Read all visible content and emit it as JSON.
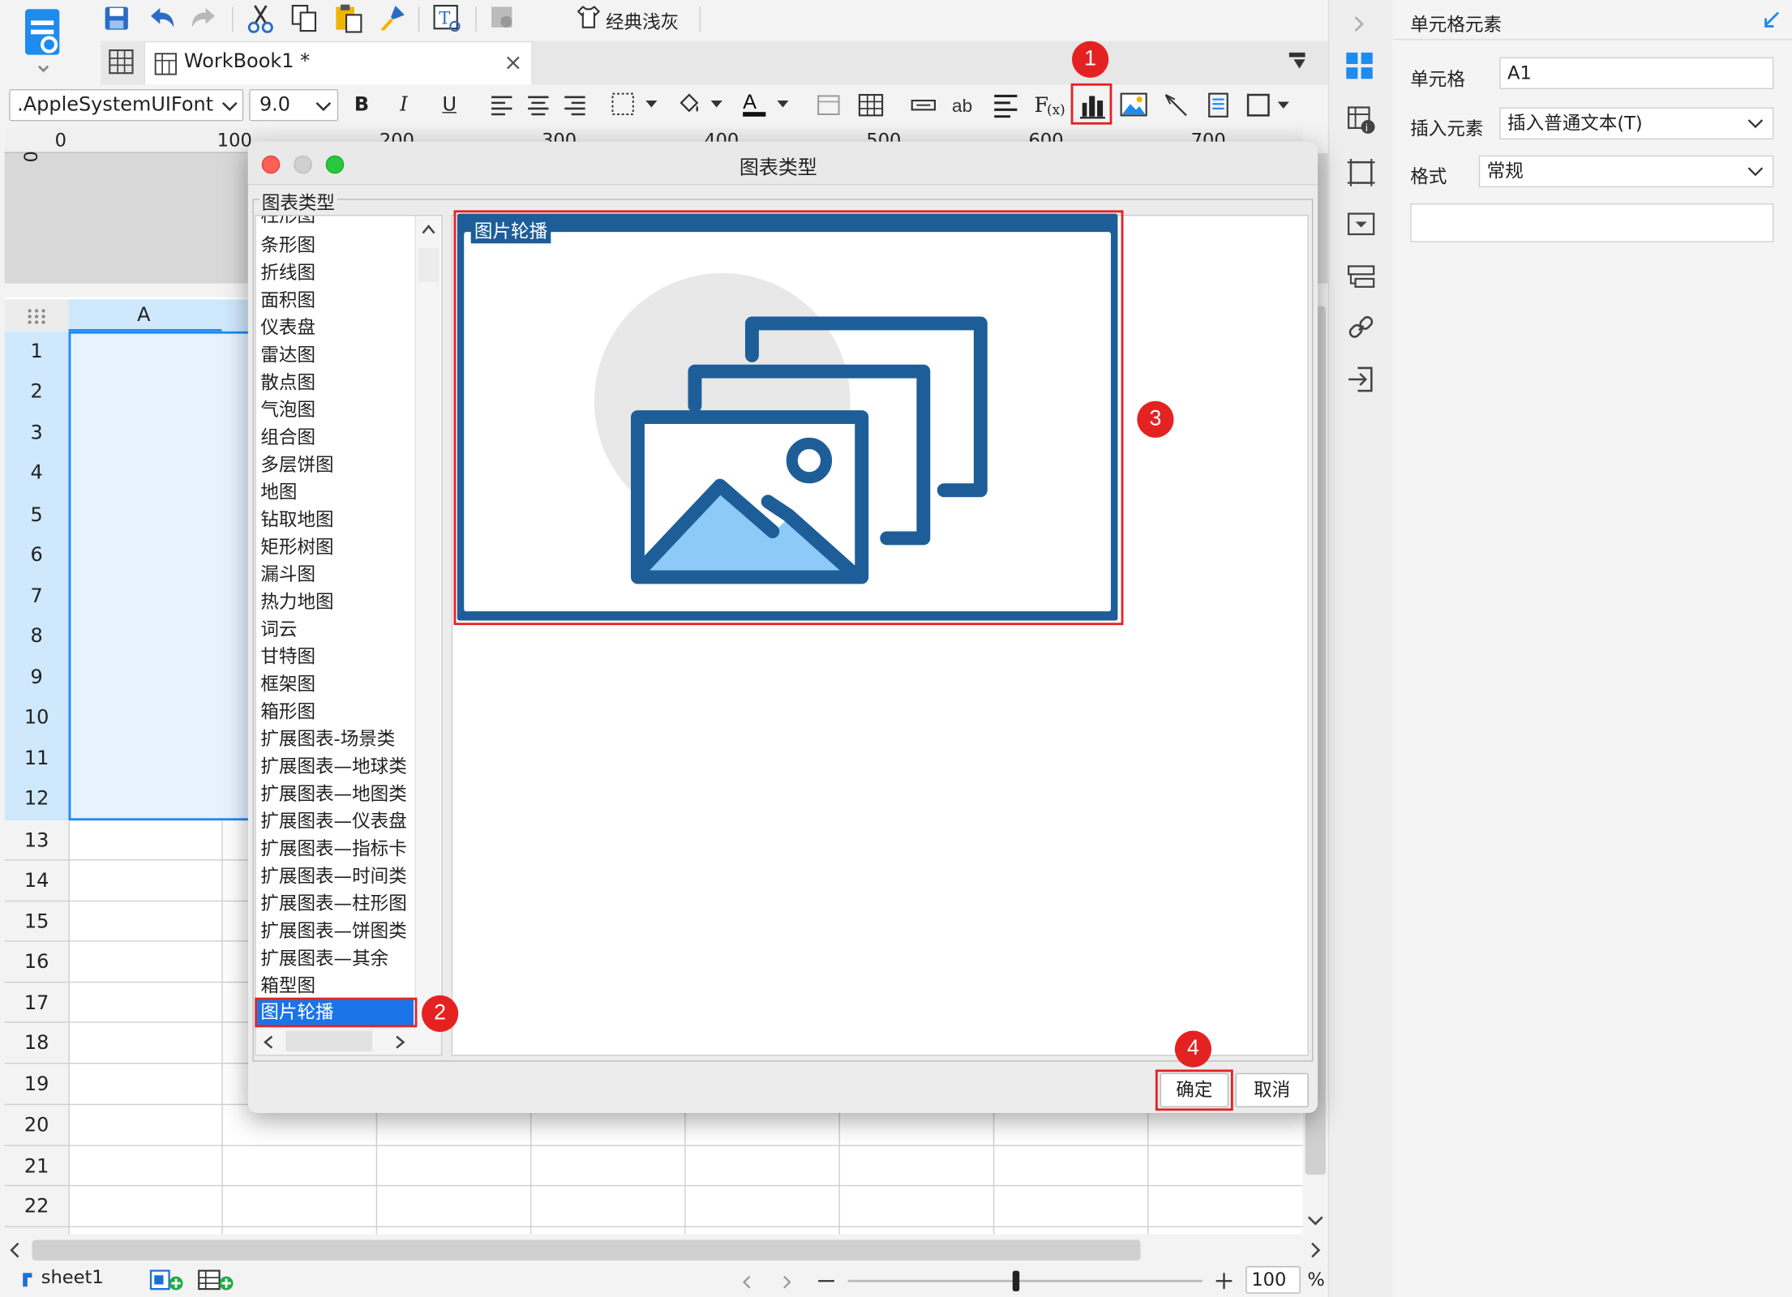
{
  "toolbar": {
    "theme_label": "经典浅灰",
    "font_name": ".AppleSystemUIFont",
    "font_size": "9.0",
    "bold": "B",
    "italic": "I",
    "underline": "U"
  },
  "tabs": {
    "workbook_label": "WorkBook1 *"
  },
  "ruler": {
    "ticks": [
      "0",
      "100",
      "200",
      "300",
      "400",
      "500",
      "600",
      "700"
    ]
  },
  "sheet": {
    "column_a": "A",
    "row_numbers": [
      "1",
      "2",
      "3",
      "4",
      "5",
      "6",
      "7",
      "8",
      "9",
      "10",
      "11",
      "12",
      "13",
      "14",
      "15",
      "16",
      "17",
      "18",
      "19",
      "20",
      "21",
      "22"
    ],
    "sheet_tab": "sheet1",
    "zoom": "100",
    "zoom_unit": "%"
  },
  "dialog": {
    "title": "图表类型",
    "group_label": "图表类型",
    "chart_types": [
      "柱形图",
      "条形图",
      "折线图",
      "面积图",
      "仪表盘",
      "雷达图",
      "散点图",
      "气泡图",
      "组合图",
      "多层饼图",
      "地图",
      "钻取地图",
      "矩形树图",
      "漏斗图",
      "热力地图",
      "词云",
      "甘特图",
      "框架图",
      "箱形图",
      "扩展图表-场景类",
      "扩展图表—地球类",
      "扩展图表—地图类",
      "扩展图表—仪表盘",
      "扩展图表—指标卡",
      "扩展图表—时间类",
      "扩展图表—柱形图",
      "扩展图表—饼图类",
      "扩展图表—其余",
      "箱型图",
      "图片轮播"
    ],
    "selected_type": "图片轮播",
    "preview_label": "图片轮播",
    "ok_label": "确定",
    "cancel_label": "取消"
  },
  "badges": [
    "1",
    "2",
    "3",
    "4"
  ],
  "side_panel": {
    "title": "单元格元素",
    "cell_label": "单元格",
    "cell_value": "A1",
    "insert_label": "插入元素",
    "insert_value": "插入普通文本(T)",
    "format_label": "格式",
    "format_value": "常规"
  },
  "colors": {
    "accent_blue": "#1d8bf0",
    "selection_blue": "#1b73e8",
    "preview_frame": "#1e5e98",
    "highlight_red": "#e52222",
    "picture_light": "#8ecaf7"
  }
}
